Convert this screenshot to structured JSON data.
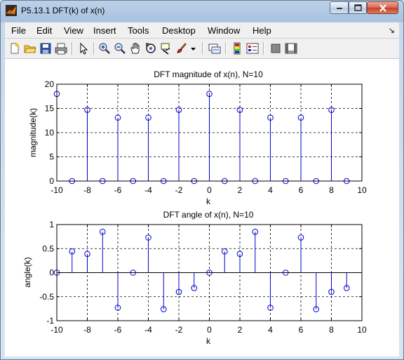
{
  "window": {
    "title": "P5.13.1 DFT(k) of x(n)"
  },
  "menu": {
    "items": [
      {
        "label": "File"
      },
      {
        "label": "Edit"
      },
      {
        "label": "View"
      },
      {
        "label": "Insert"
      },
      {
        "label": "Tools"
      },
      {
        "label": "Desktop"
      },
      {
        "label": "Window"
      },
      {
        "label": "Help"
      }
    ]
  },
  "toolbar": {
    "icons": [
      "new-figure-icon",
      "open-file-icon",
      "save-icon",
      "print-icon",
      "pointer-icon",
      "zoom-in-icon",
      "zoom-out-icon",
      "pan-hand-icon",
      "rotate-3d-icon",
      "data-cursor-icon",
      "brush-icon",
      "brush-dropdown-icon",
      "link-plot-icon",
      "colorbar-icon",
      "legend-icon",
      "hide-plot-tools-icon",
      "show-plot-tools-icon"
    ]
  },
  "colors": {
    "stem": "#0000cc",
    "grid": "#000000",
    "background": "#ffffff"
  },
  "chart_data": [
    {
      "type": "stem",
      "title": "DFT magnitude of x(n), N=10",
      "xlabel": "k",
      "ylabel": "magnitude(k)",
      "xlim": [
        -10,
        10
      ],
      "ylim": [
        0,
        20
      ],
      "xticks": [
        "-10",
        "-8",
        "-6",
        "-4",
        "-2",
        "0",
        "2",
        "4",
        "6",
        "8",
        "10"
      ],
      "yticks": [
        "0",
        "5",
        "10",
        "15",
        "20"
      ],
      "grid": true,
      "x": [
        -10,
        -9,
        -8,
        -7,
        -6,
        -5,
        -4,
        -3,
        -2,
        -1,
        0,
        1,
        2,
        3,
        4,
        5,
        6,
        7,
        8,
        9
      ],
      "y": [
        18,
        0,
        14.7,
        0,
        13.1,
        0,
        13.1,
        0,
        14.7,
        0,
        18,
        0,
        14.7,
        0,
        13.1,
        0,
        13.1,
        0,
        14.7,
        0
      ]
    },
    {
      "type": "stem",
      "title": "DFT angle of x(n), N=10",
      "xlabel": "k",
      "ylabel": "angle(k)",
      "xlim": [
        -10,
        10
      ],
      "ylim": [
        -1,
        1
      ],
      "xticks": [
        "-10",
        "-8",
        "-6",
        "-4",
        "-2",
        "0",
        "2",
        "4",
        "6",
        "8",
        "10"
      ],
      "yticks": [
        "-1",
        "-0.5",
        "0",
        "0.5",
        "1"
      ],
      "grid": true,
      "x": [
        -10,
        -9,
        -8,
        -7,
        -6,
        -5,
        -4,
        -3,
        -2,
        -1,
        0,
        1,
        2,
        3,
        4,
        5,
        6,
        7,
        8,
        9
      ],
      "y": [
        0,
        0.44,
        0.39,
        0.85,
        -0.73,
        0,
        0.73,
        -0.76,
        -0.4,
        -0.32,
        0,
        0.44,
        0.39,
        0.85,
        -0.73,
        0,
        0.73,
        -0.76,
        -0.4,
        -0.32
      ]
    }
  ]
}
